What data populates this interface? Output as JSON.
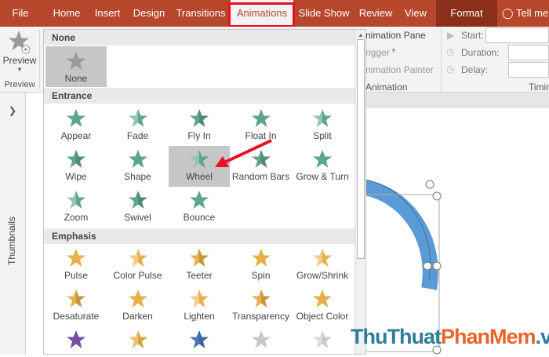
{
  "tabs": [
    "File",
    "Home",
    "Insert",
    "Design",
    "Transitions",
    "Animations",
    "Slide Show",
    "Review",
    "View",
    "Format"
  ],
  "tell_me": "Tell me",
  "ribbon": {
    "preview_label": "Preview",
    "preview_group": "Preview",
    "animation_pane": "nimation Pane",
    "trigger": "rigger",
    "animation_painter": "nimation Painter",
    "animation_group": "Animation",
    "start": "Start:",
    "duration": "Duration:",
    "delay": "Delay:",
    "timing": "Timin"
  },
  "sidebar": {
    "thumbnails": "Thumbnails"
  },
  "gallery": {
    "none_header": "None",
    "none_item": "None",
    "entrance_header": "Entrance",
    "entrance": [
      "Appear",
      "Fade",
      "Fly In",
      "Float In",
      "Split",
      "Wipe",
      "Shape",
      "Wheel",
      "Random Bars",
      "Grow & Turn",
      "Zoom",
      "Swivel",
      "Bounce"
    ],
    "selected": "Wheel",
    "emphasis_header": "Emphasis",
    "emphasis": [
      "Pulse",
      "Color Pulse",
      "Teeter",
      "Spin",
      "Grow/Shrink",
      "Desaturate",
      "Darken",
      "Lighten",
      "Transparency",
      "Object Color"
    ]
  },
  "watermark": {
    "part1": "ThuThuat",
    "part2": "PhanMem",
    "part3": ".vn"
  },
  "colors": {
    "accent": "#b7472a",
    "entrance_star": "#5fa58a",
    "emphasis_star": "#e8b04a",
    "highlight": "#e81123",
    "circle": "#5b9bd5"
  }
}
